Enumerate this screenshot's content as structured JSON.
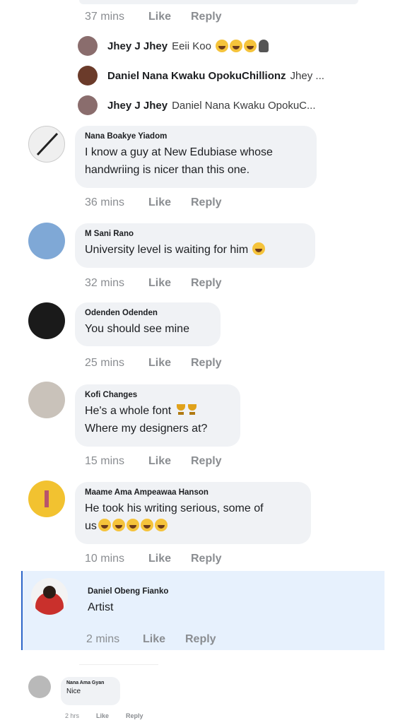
{
  "top_comment": {
    "time": "37 mins",
    "like": "Like",
    "reply": "Reply"
  },
  "replies": [
    {
      "name": "Jhey J Jhey",
      "text": "Eeii Koo",
      "avatar_color": "#8a6d6d",
      "emoji_count": 3,
      "extra": "ghost"
    },
    {
      "name": "Daniel Nana Kwaku OpokuChillionz",
      "text": "Jhey ...",
      "avatar_color": "#6b3b2a"
    },
    {
      "name": "Jhey J Jhey",
      "text": "Daniel Nana Kwaku OpokuC...",
      "avatar_color": "#8a6d6d"
    }
  ],
  "comments": [
    {
      "name": "Nana Boakye Yiadom",
      "text": "I know a guy at New Edubiase whose\nhandwriing is nicer than this one.",
      "time": "36 mins",
      "like": "Like",
      "reply": "Reply",
      "avatar_color": "#e6e6e6",
      "avatar_icon": "pen-icon"
    },
    {
      "name": "M Sani Rano",
      "text": "University level is waiting for him",
      "time": "32 mins",
      "like": "Like",
      "reply": "Reply",
      "avatar_color": "#7fa8d6",
      "emoji_count": 1
    },
    {
      "name": "Odenden Odenden",
      "text": "You should see mine",
      "time": "25 mins",
      "like": "Like",
      "reply": "Reply",
      "avatar_color": "#1a1a1a"
    },
    {
      "name": "Kofi Changes",
      "text": "He's a whole font",
      "text2": "Where my designers at?",
      "time": "15 mins",
      "like": "Like",
      "reply": "Reply",
      "avatar_color": "#c9c2ba",
      "trophy_count": 2
    },
    {
      "name": "Maame Ama Ampeawaa Hanson",
      "text": "He took his writing serious, some of",
      "text2": "us",
      "time": "10 mins",
      "like": "Like",
      "reply": "Reply",
      "avatar_color": "#f2c230",
      "emoji_count": 5
    },
    {
      "name": "Daniel Obeng Fianko",
      "text": "Artist",
      "time": "2 mins",
      "like": "Like",
      "reply": "Reply",
      "avatar_color": "#c9302c"
    },
    {
      "name": "Nana Ama Gyan",
      "text": "Nice",
      "time": "2 hrs",
      "like": "Like",
      "reply": "Reply",
      "avatar_color": "#b9b9b9"
    }
  ]
}
